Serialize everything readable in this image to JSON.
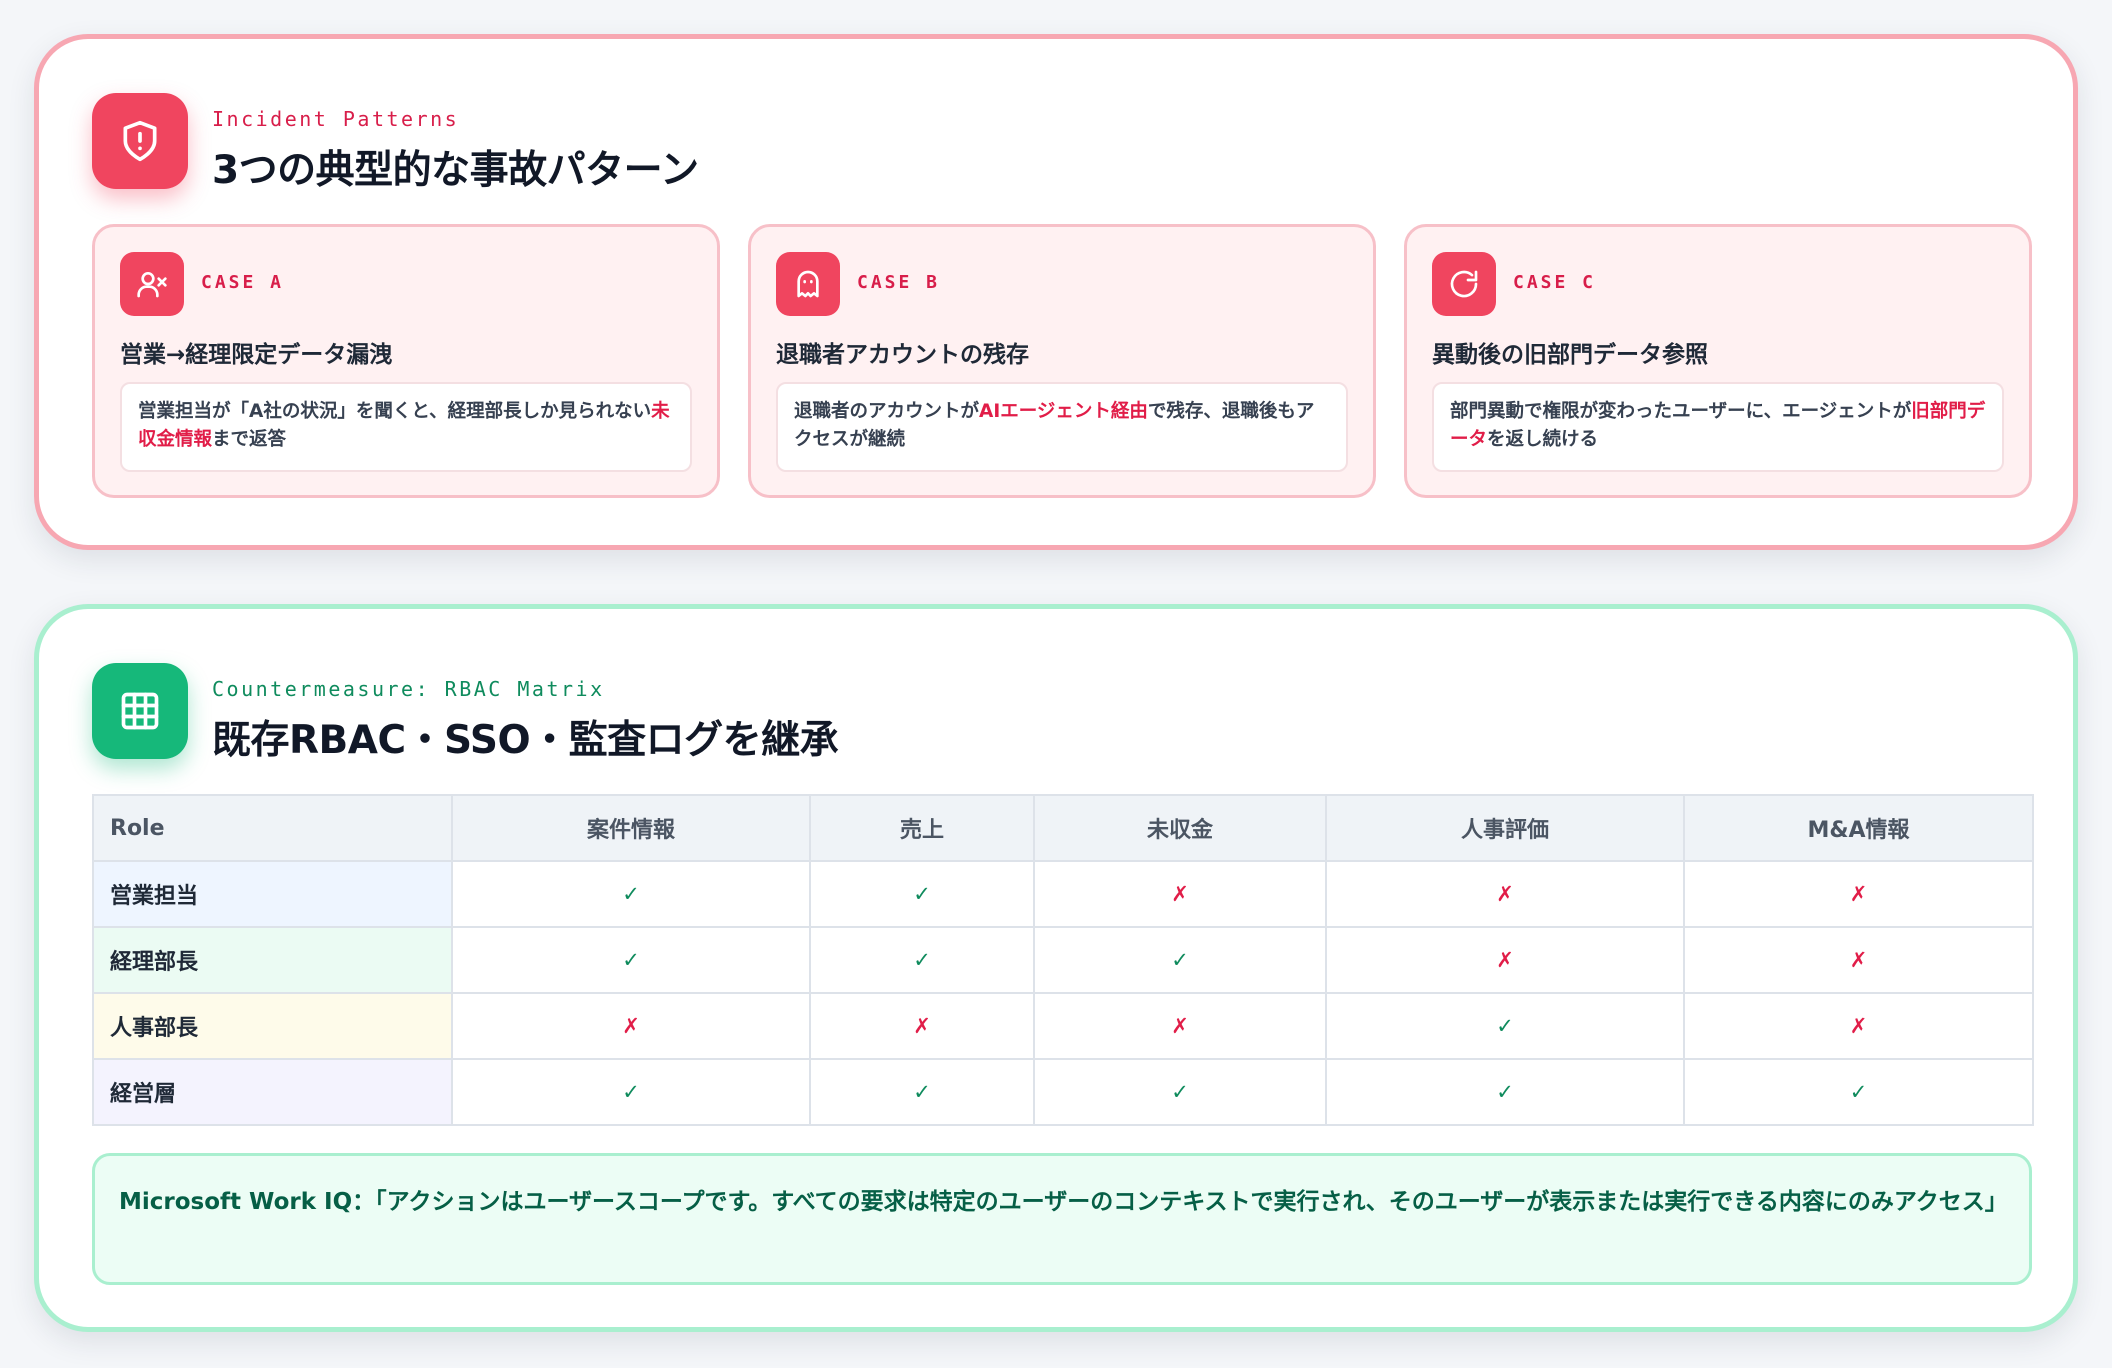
{
  "incident": {
    "eyebrow": "Incident Patterns",
    "title": "3つの典型的な事故パターン",
    "cases": [
      {
        "label": "CASE A",
        "title": "営業→経理限定データ漏洩",
        "desc_pre": "営業担当が「A社の状況」を聞くと、経理部長しか見られない",
        "desc_hl": "未収金情報",
        "desc_post": "まで返答"
      },
      {
        "label": "CASE B",
        "title": "退職者アカウントの残存",
        "desc_pre": "退職者のアカウントが",
        "desc_hl": "AIエージェント経由",
        "desc_post": "で残存、退職後もアクセスが継続"
      },
      {
        "label": "CASE C",
        "title": "異動後の旧部門データ参照",
        "desc_pre": "部門異動で権限が変わったユーザーに、エージェントが",
        "desc_hl": "旧部門データ",
        "desc_post": "を返し続ける"
      }
    ]
  },
  "countermeasure": {
    "eyebrow": "Countermeasure: RBAC Matrix",
    "title": "既存RBAC・SSO・監査ログを継承",
    "table": {
      "headers": [
        "Role",
        "案件情報",
        "売上",
        "未収金",
        "人事評価",
        "M&A情報"
      ],
      "rows": [
        {
          "role": "営業担当",
          "bg": "#eef5ff",
          "cells": [
            "✓",
            "✓",
            "✗",
            "✗",
            "✗"
          ]
        },
        {
          "role": "経理部長",
          "bg": "#ebfbf3",
          "cells": [
            "✓",
            "✓",
            "✓",
            "✗",
            "✗"
          ]
        },
        {
          "role": "人事部長",
          "bg": "#fefbea",
          "cells": [
            "✗",
            "✗",
            "✗",
            "✓",
            "✗"
          ]
        },
        {
          "role": "経営層",
          "bg": "#f4f3fe",
          "cells": [
            "✓",
            "✓",
            "✓",
            "✓",
            "✓"
          ]
        }
      ]
    },
    "quote": "Microsoft Work IQ：「アクションはユーザースコープです。すべての要求は特定のユーザーのコンテキストで実行され、そのユーザーが表示または実行できる内容にのみアクセス」"
  },
  "icons": {
    "incident": "shield-alert-icon",
    "case_a": "user-x-icon",
    "case_b": "ghost-icon",
    "case_c": "rotate-cw-icon",
    "countermeasure": "grid-icon"
  },
  "colors": {
    "accent_red": "#f0455f",
    "accent_green": "#16b87a",
    "check_green": "#0f8b5d",
    "cross_red": "#e11d48"
  }
}
